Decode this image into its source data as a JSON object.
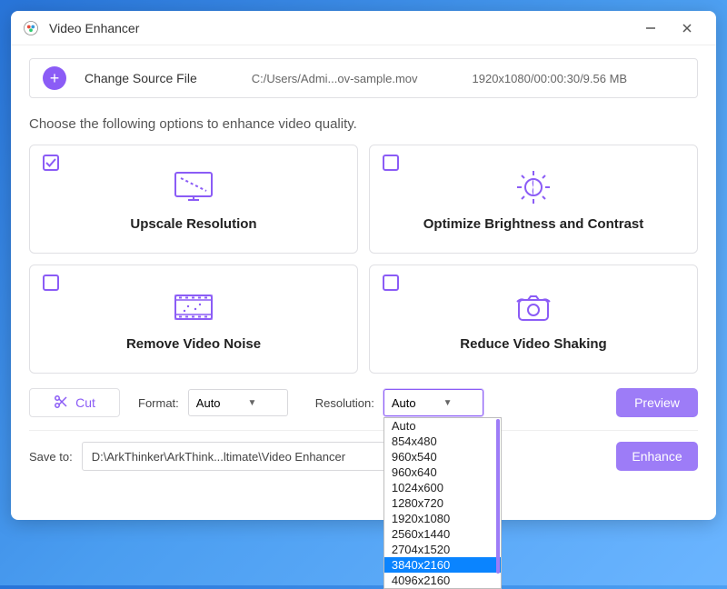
{
  "window": {
    "title": "Video Enhancer"
  },
  "source": {
    "change_label": "Change Source File",
    "path": "C:/Users/Admi...ov-sample.mov",
    "meta": "1920x1080/00:00:30/9.56 MB"
  },
  "instruction": "Choose the following options to enhance video quality.",
  "options": {
    "upscale": {
      "label": "Upscale Resolution",
      "checked": true
    },
    "brightness": {
      "label": "Optimize Brightness and Contrast",
      "checked": false
    },
    "noise": {
      "label": "Remove Video Noise",
      "checked": false
    },
    "shaking": {
      "label": "Reduce Video Shaking",
      "checked": false
    }
  },
  "controls": {
    "cut_label": "Cut",
    "format_label": "Format:",
    "format_value": "Auto",
    "resolution_label": "Resolution:",
    "resolution_value": "Auto",
    "resolution_options": [
      "Auto",
      "854x480",
      "960x540",
      "960x640",
      "1024x600",
      "1280x720",
      "1920x1080",
      "2560x1440",
      "2704x1520",
      "3840x2160",
      "4096x2160"
    ],
    "resolution_highlighted": "3840x2160",
    "preview_label": "Preview"
  },
  "save": {
    "label": "Save to:",
    "path": "D:\\ArkThinker\\ArkThink...ltimate\\Video Enhancer",
    "enhance_label": "Enhance"
  },
  "colors": {
    "accent": "#8b5cf6",
    "button": "#9d7cf7"
  }
}
